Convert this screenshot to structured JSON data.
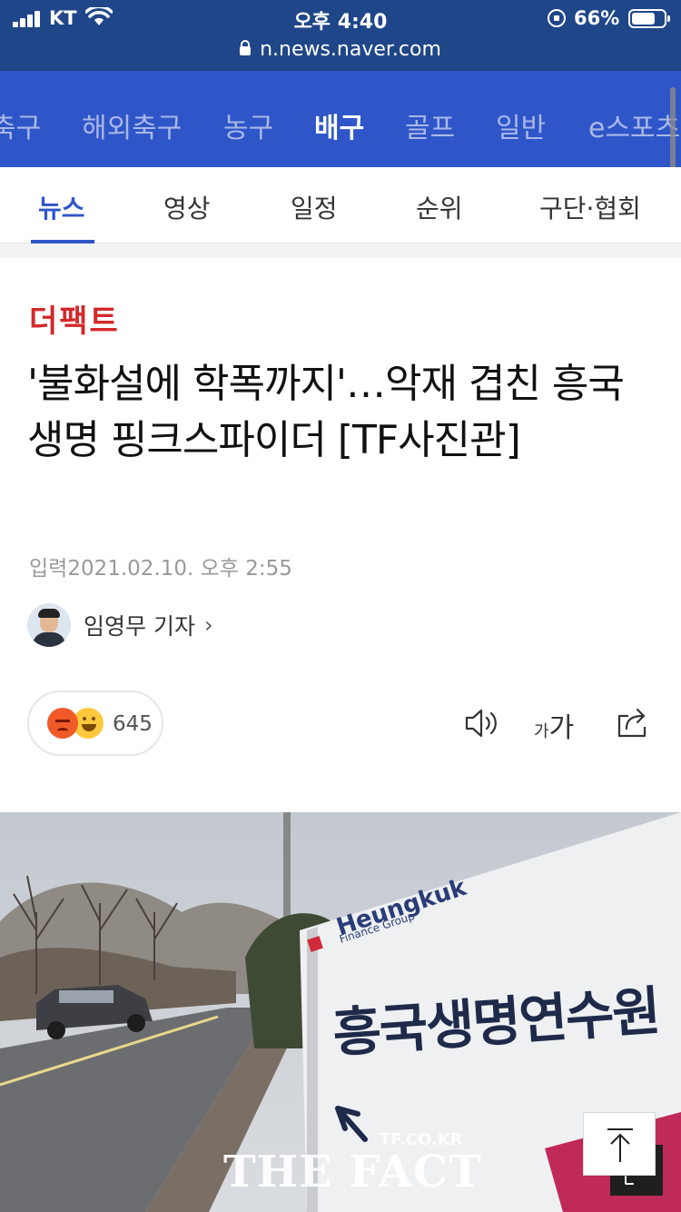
{
  "status_bar": {
    "carrier": "KT",
    "time": "오후 4:40",
    "battery": "66%",
    "battery_level": 0.66
  },
  "browser": {
    "url": "n.news.naver.com"
  },
  "category_nav": {
    "items": [
      {
        "label": "축구",
        "active": false
      },
      {
        "label": "해외축구",
        "active": false
      },
      {
        "label": "농구",
        "active": false
      },
      {
        "label": "배구",
        "active": true
      },
      {
        "label": "골프",
        "active": false
      },
      {
        "label": "일반",
        "active": false
      },
      {
        "label": "e스포츠",
        "active": false
      }
    ]
  },
  "sub_tabs": {
    "items": [
      {
        "label": "뉴스",
        "active": true
      },
      {
        "label": "영상",
        "active": false
      },
      {
        "label": "일정",
        "active": false
      },
      {
        "label": "순위",
        "active": false
      },
      {
        "label": "구단·협회",
        "active": false
      }
    ]
  },
  "article": {
    "press": "더팩트",
    "headline": "'불화설에 학폭까지'…악재 겹친 흥국생명 핑크스파이더 [TF사진관]",
    "input_label": "입력",
    "datetime": "2021.02.10. 오후 2:55",
    "reporter": "임영무 기자",
    "reaction_count": "645",
    "font_size_small": "가",
    "font_size_large": "가"
  },
  "photo": {
    "sign_brand": "Heungkuk",
    "sign_sub": "Finance Group",
    "sign_text": "흥국생명연수원",
    "watermark_site": "TF.CO.KR",
    "watermark_brand": "THE FACT"
  },
  "colors": {
    "browser_bar": "#1f4688",
    "category_bg": "#2f56c8",
    "active_tab": "#2f56c8",
    "press": "#d3282a"
  }
}
